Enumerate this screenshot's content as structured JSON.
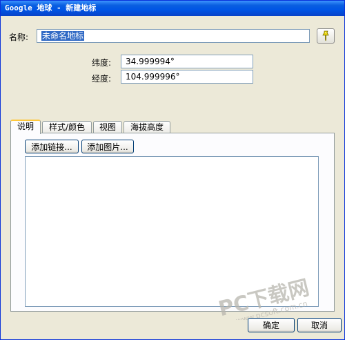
{
  "window": {
    "title": "Google 地球 - 新建地标"
  },
  "form": {
    "name_label": "名称:",
    "name_value": "未命名地标",
    "lat_label": "纬度:",
    "lat_value": "34.999994°",
    "lon_label": "经度:",
    "lon_value": "104.999996°"
  },
  "tabs": [
    {
      "label": "说明"
    },
    {
      "label": "样式/颜色"
    },
    {
      "label": "视图"
    },
    {
      "label": "海拔高度"
    }
  ],
  "description": {
    "add_link_label": "添加链接...",
    "add_image_label": "添加图片..."
  },
  "footer": {
    "ok_label": "确定",
    "cancel_label": "取消"
  },
  "watermark": {
    "main": "PC下载网",
    "sub": "www.pcsoft.com.cn"
  },
  "icons": {
    "pin": "pushpin-icon"
  },
  "colors": {
    "title_bar": "#0a5fe0",
    "selection": "#316ac5",
    "active_tab_accent": "#ffc83c",
    "pin": "#e6d200"
  }
}
